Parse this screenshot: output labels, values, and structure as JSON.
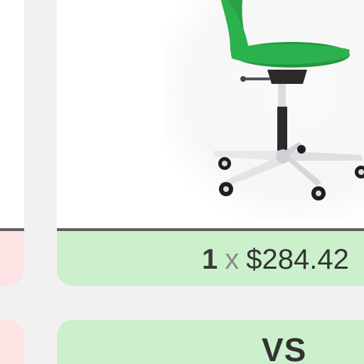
{
  "product_card": {
    "image": {
      "icon": "office-chair-icon",
      "seat_color": "#27a046",
      "base_color": "#e6e6ea"
    },
    "price_row": {
      "quantity": "1",
      "times_symbol": "x",
      "price": "$284.42"
    },
    "vs_row": {
      "label": "VS"
    }
  },
  "colors": {
    "price_row_bg": "#cdf0cc",
    "left_card_bg": "#fde3e3",
    "divider": "#5f5f5f",
    "page_bg": "#f1f1f1"
  }
}
